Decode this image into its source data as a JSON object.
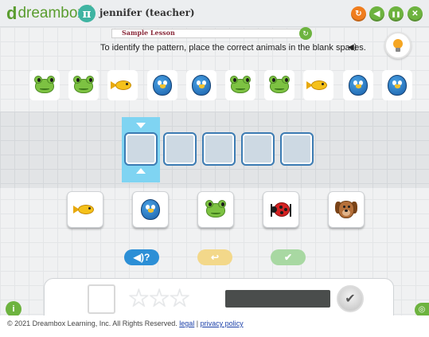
{
  "header": {
    "logo_letter": "d",
    "logo_text": "dreambox",
    "logo_mark": "™",
    "avatar_glyph": "π",
    "user_name": "jennifer (teacher)",
    "controls": [
      {
        "name": "back-icon",
        "glyph": "↻",
        "color": "#f07d1e"
      },
      {
        "name": "sound-icon",
        "glyph": "◀",
        "color": "#6db33f"
      },
      {
        "name": "pause-icon",
        "glyph": "❚❚",
        "color": "#6db33f"
      },
      {
        "name": "close-icon",
        "glyph": "✕",
        "color": "#6db33f"
      }
    ]
  },
  "lesson": {
    "label": "Sample Lesson",
    "nav_glyph": "↻",
    "instruction": "To identify the pattern, place the correct animals in the blank spaces.",
    "speaker_glyph": "◀)"
  },
  "sequence": [
    "frog",
    "frog",
    "fish",
    "bird",
    "bird",
    "frog",
    "frog",
    "fish",
    "bird",
    "bird"
  ],
  "answer_slots": 5,
  "choices": [
    "fish",
    "bird",
    "frog",
    "ladybug",
    "dog"
  ],
  "actions": {
    "audio_label": "◀)?",
    "undo_label": "↩",
    "check_label": "✔"
  },
  "tray": {
    "stars": "☆☆☆",
    "done_glyph": "✔"
  },
  "corner": {
    "info_label": "i",
    "chat_label": "◎"
  },
  "footer": {
    "copyright": "© 2021 Dreambox Learning, Inc. All Rights Reserved.",
    "legal": "legal",
    "separator": " | ",
    "privacy": "privacy policy"
  }
}
